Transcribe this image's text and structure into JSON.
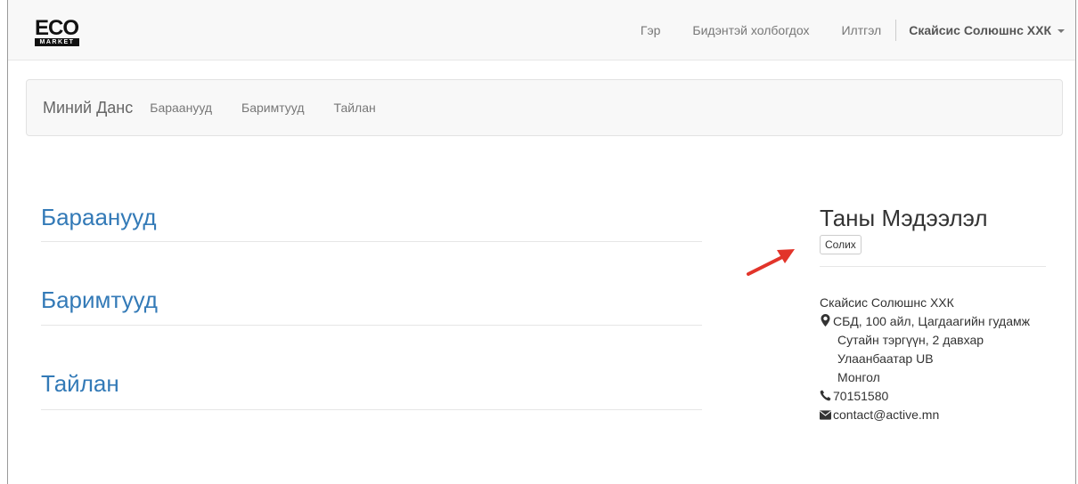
{
  "logo": {
    "top": "ECO",
    "bottom": "MARKET"
  },
  "topnav": {
    "home": "Гэр",
    "contact": "Бидэнтэй холбогдох",
    "messages": "Илтгэл",
    "user": "Скайсис Солюшнс ХХК"
  },
  "subnav": {
    "brand": "Миний Данс",
    "items": [
      "Бараанууд",
      "Баримтууд",
      "Тайлан"
    ]
  },
  "sections": [
    "Бараанууд",
    "Баримтууд",
    "Тайлан"
  ],
  "profile": {
    "title": "Таны Мэдээлэл",
    "edit_label": "Солих",
    "company": "Скайсис Солюшнс ХХК",
    "address_line1": "СБД, 100 айл, Цагдаагийн гудамж",
    "address_line2": "Сутайн тэргүүн, 2 давхар",
    "city": "Улаанбаатар UB",
    "country": "Монгол",
    "phone": "70151580",
    "email": "contact@active.mn"
  },
  "colors": {
    "link": "#337ab7",
    "arrow": "#e2342a"
  }
}
